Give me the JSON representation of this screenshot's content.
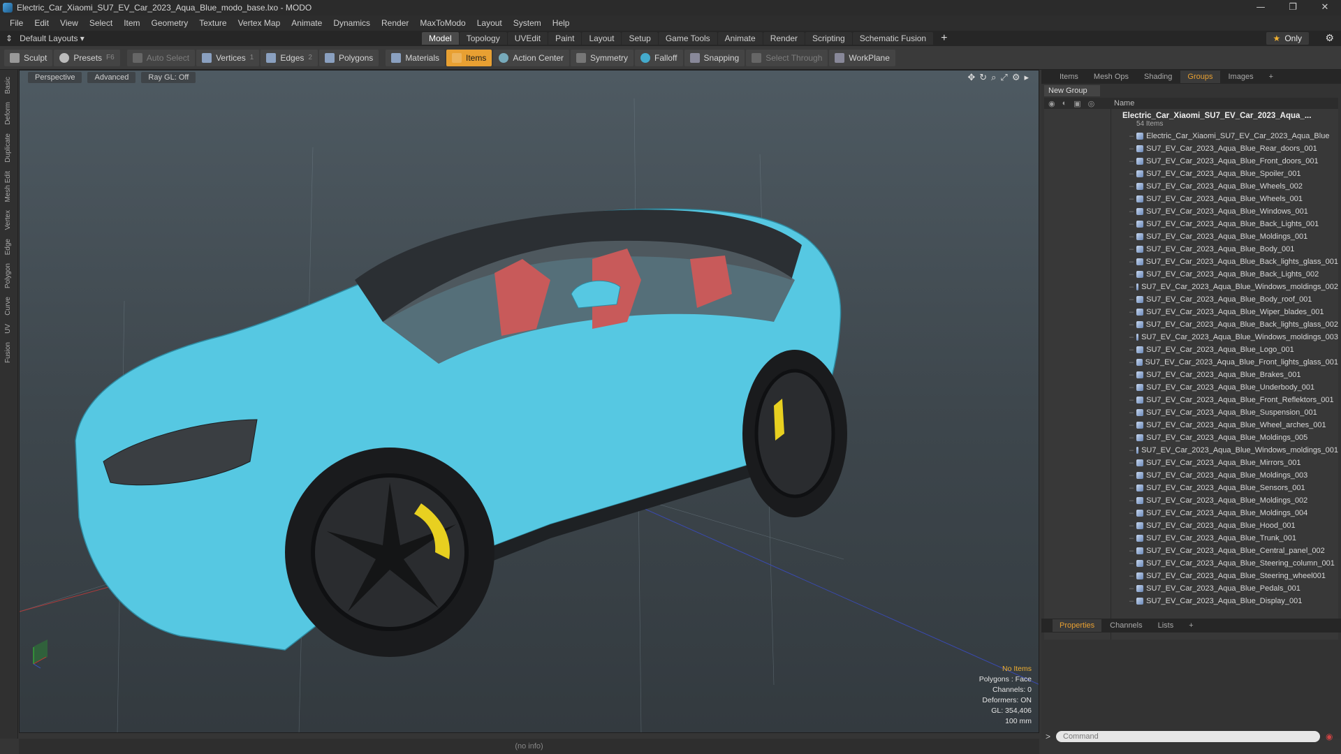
{
  "window": {
    "title": "Electric_Car_Xiaomi_SU7_EV_Car_2023_Aqua_Blue_modo_base.lxo - MODO",
    "minimize": "—",
    "restore": "❐",
    "close": "✕"
  },
  "menu": [
    "File",
    "Edit",
    "View",
    "Select",
    "Item",
    "Geometry",
    "Texture",
    "Vertex Map",
    "Animate",
    "Dynamics",
    "Render",
    "MaxToModo",
    "Layout",
    "System",
    "Help"
  ],
  "layout_selector": "Default Layouts ▾",
  "mode_tabs": [
    {
      "label": "Model",
      "active": true
    },
    {
      "label": "Topology"
    },
    {
      "label": "UVEdit"
    },
    {
      "label": "Paint"
    },
    {
      "label": "Layout"
    },
    {
      "label": "Setup"
    },
    {
      "label": "Game Tools"
    },
    {
      "label": "Animate"
    },
    {
      "label": "Render"
    },
    {
      "label": "Scripting"
    },
    {
      "label": "Schematic Fusion"
    }
  ],
  "only_label": "Only",
  "toolbar": {
    "sculpt": "Sculpt",
    "presets": "Presets",
    "presets_key": "F6",
    "auto_select": "Auto Select",
    "vertices": "Vertices",
    "vertices_key": "1",
    "edges": "Edges",
    "edges_key": "2",
    "polygons": "Polygons",
    "materials": "Materials",
    "items": "Items",
    "action_center": "Action Center",
    "symmetry": "Symmetry",
    "falloff": "Falloff",
    "snapping": "Snapping",
    "select_through": "Select Through",
    "workplane": "WorkPlane"
  },
  "left_tabs": [
    "Basic",
    "Deform",
    "Duplicate",
    "Mesh Edit",
    "Vertex",
    "Edge",
    "Polygon",
    "Curve",
    "UV",
    "Fusion"
  ],
  "viewport": {
    "view": "Perspective",
    "shading": "Advanced",
    "raygl": "Ray GL: Off",
    "info": {
      "no_items": "No Items",
      "polygons": "Polygons : Face",
      "channels": "Channels: 0",
      "deformers": "Deformers: ON",
      "gl": "GL: 354,406",
      "unit": "100 mm"
    }
  },
  "panel_tabs": [
    {
      "label": "Items"
    },
    {
      "label": "Mesh Ops"
    },
    {
      "label": "Shading"
    },
    {
      "label": "Groups",
      "active": true
    },
    {
      "label": "Images"
    }
  ],
  "new_group": "New Group",
  "list_header": "Name",
  "group": {
    "name": "Electric_Car_Xiaomi_SU7_EV_Car_2023_Aqua_...",
    "count": "54 Items"
  },
  "items": [
    "Electric_Car_Xiaomi_SU7_EV_Car_2023_Aqua_Blue",
    "SU7_EV_Car_2023_Aqua_Blue_Rear_doors_001",
    "SU7_EV_Car_2023_Aqua_Blue_Front_doors_001",
    "SU7_EV_Car_2023_Aqua_Blue_Spoiler_001",
    "SU7_EV_Car_2023_Aqua_Blue_Wheels_002",
    "SU7_EV_Car_2023_Aqua_Blue_Wheels_001",
    "SU7_EV_Car_2023_Aqua_Blue_Windows_001",
    "SU7_EV_Car_2023_Aqua_Blue_Back_Lights_001",
    "SU7_EV_Car_2023_Aqua_Blue_Moldings_001",
    "SU7_EV_Car_2023_Aqua_Blue_Body_001",
    "SU7_EV_Car_2023_Aqua_Blue_Back_lights_glass_001",
    "SU7_EV_Car_2023_Aqua_Blue_Back_Lights_002",
    "SU7_EV_Car_2023_Aqua_Blue_Windows_moldings_002",
    "SU7_EV_Car_2023_Aqua_Blue_Body_roof_001",
    "SU7_EV_Car_2023_Aqua_Blue_Wiper_blades_001",
    "SU7_EV_Car_2023_Aqua_Blue_Back_lights_glass_002",
    "SU7_EV_Car_2023_Aqua_Blue_Windows_moldings_003",
    "SU7_EV_Car_2023_Aqua_Blue_Logo_001",
    "SU7_EV_Car_2023_Aqua_Blue_Front_lights_glass_001",
    "SU7_EV_Car_2023_Aqua_Blue_Brakes_001",
    "SU7_EV_Car_2023_Aqua_Blue_Underbody_001",
    "SU7_EV_Car_2023_Aqua_Blue_Front_Reflektors_001",
    "SU7_EV_Car_2023_Aqua_Blue_Suspension_001",
    "SU7_EV_Car_2023_Aqua_Blue_Wheel_arches_001",
    "SU7_EV_Car_2023_Aqua_Blue_Moldings_005",
    "SU7_EV_Car_2023_Aqua_Blue_Windows_moldings_001",
    "SU7_EV_Car_2023_Aqua_Blue_Mirrors_001",
    "SU7_EV_Car_2023_Aqua_Blue_Moldings_003",
    "SU7_EV_Car_2023_Aqua_Blue_Sensors_001",
    "SU7_EV_Car_2023_Aqua_Blue_Moldings_002",
    "SU7_EV_Car_2023_Aqua_Blue_Moldings_004",
    "SU7_EV_Car_2023_Aqua_Blue_Hood_001",
    "SU7_EV_Car_2023_Aqua_Blue_Trunk_001",
    "SU7_EV_Car_2023_Aqua_Blue_Central_panel_002",
    "SU7_EV_Car_2023_Aqua_Blue_Steering_column_001",
    "SU7_EV_Car_2023_Aqua_Blue_Steering_wheel001",
    "SU7_EV_Car_2023_Aqua_Blue_Pedals_001",
    "SU7_EV_Car_2023_Aqua_Blue_Display_001"
  ],
  "props_tabs": [
    {
      "label": "Properties",
      "active": true
    },
    {
      "label": "Channels"
    },
    {
      "label": "Lists"
    }
  ],
  "command_placeholder": "Command",
  "status": "(no info)",
  "colors": {
    "accent": "#e8a032",
    "car_body": "#56c8e2",
    "interior": "#c85a5a",
    "caliper": "#e8d020"
  }
}
